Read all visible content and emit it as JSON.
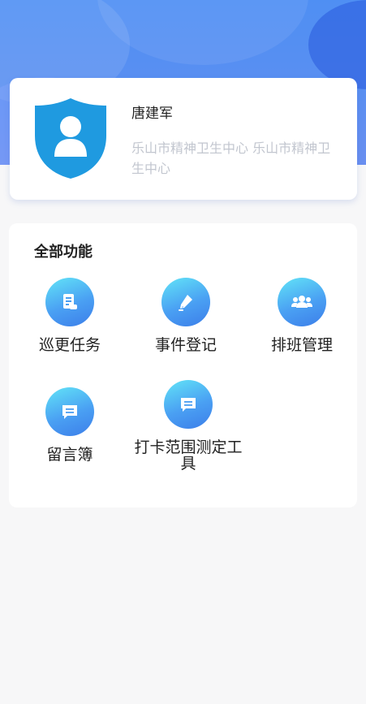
{
  "profile": {
    "name": "唐建军",
    "organization": "乐山市精神卫生中心 乐山市精神卫生中心"
  },
  "functions": {
    "title": "全部功能",
    "items": [
      {
        "label": "巡更任务",
        "icon": "document-icon"
      },
      {
        "label": "事件登记",
        "icon": "pen-icon"
      },
      {
        "label": "排班管理",
        "icon": "group-icon"
      },
      {
        "label": "留言簿",
        "icon": "message-icon"
      },
      {
        "label": "打卡范围测定工具",
        "icon": "message-icon"
      }
    ]
  },
  "colors": {
    "header_blue": "#5a8ff1",
    "shield_blue": "#1f9ae0",
    "icon_gradient_start": "#62e4f7",
    "icon_gradient_end": "#3c7ee9"
  }
}
